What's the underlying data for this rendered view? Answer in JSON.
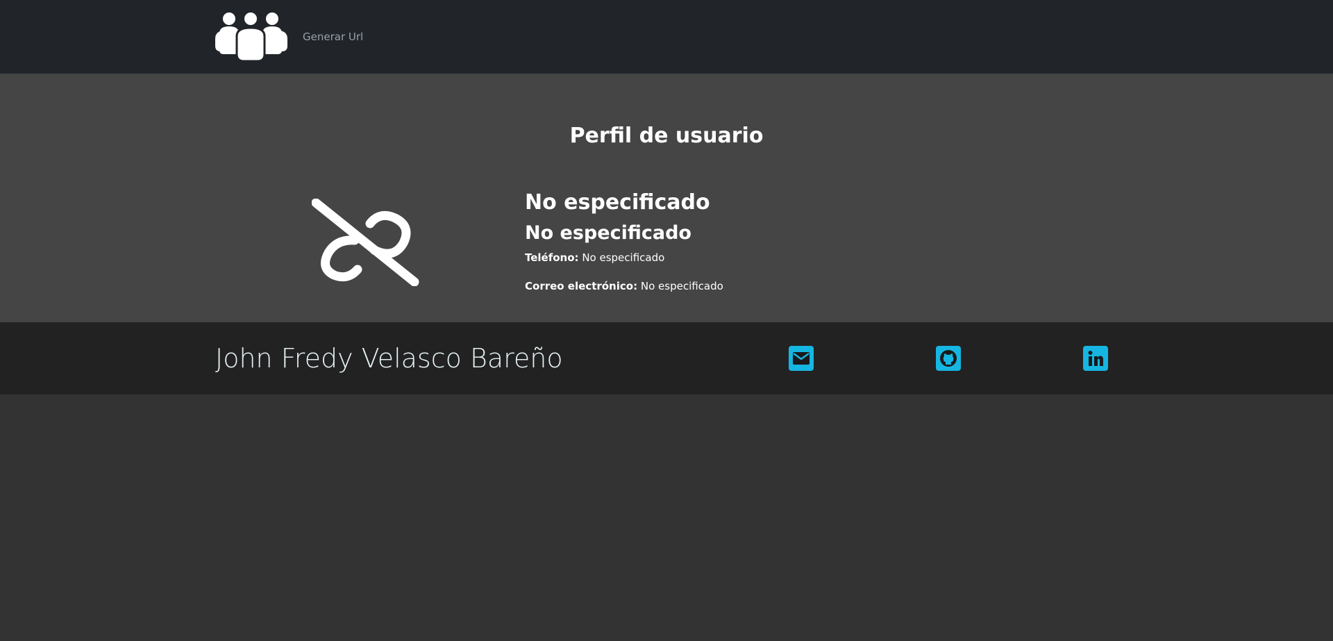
{
  "navbar": {
    "brand_icon": "users-group-icon",
    "link_label": "Generar Url"
  },
  "profile": {
    "title": "Perfil de usuario",
    "avatar_icon": "broken-link-icon",
    "name": "No especificado",
    "surname": "No especificado",
    "phone_label": "Teléfono:",
    "phone_value": "No especificado",
    "email_label": "Correo electrónico:",
    "email_value": "No especificado"
  },
  "footer": {
    "author": "John Fredy Velasco Bareño",
    "social_icons": [
      "envelope-icon",
      "github-icon",
      "linkedin-icon"
    ],
    "accent_color": "#16b6e2"
  },
  "colors": {
    "navbar_bg": "#212529",
    "profile_bg": "#454545",
    "footer_bg": "#222222",
    "page_bg": "#333333"
  }
}
